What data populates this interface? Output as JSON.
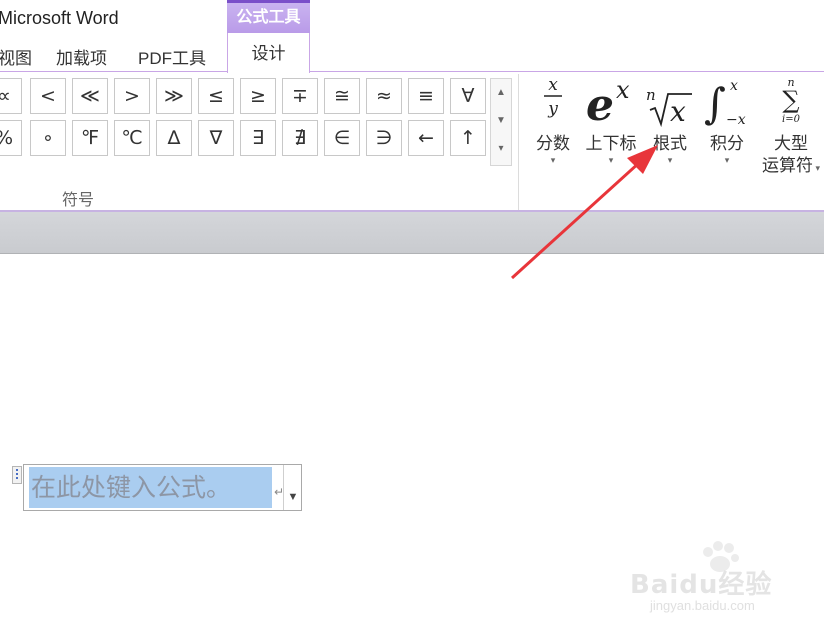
{
  "app": {
    "title": "Microsoft Word"
  },
  "context_tab": {
    "label": "公式工具"
  },
  "tabs": [
    {
      "label": "视图"
    },
    {
      "label": "加载项"
    },
    {
      "label": "PDF工具"
    }
  ],
  "active_tab": {
    "label": "设计"
  },
  "symbols": {
    "row1": [
      "∝",
      "<",
      "≪",
      ">",
      "≫",
      "≤",
      "≥",
      "∓",
      "≅",
      "≈",
      "≡",
      "∀"
    ],
    "row2": [
      "%",
      "∘",
      "℉",
      "℃",
      "∆",
      "∇",
      "∃",
      "∄",
      "∈",
      "∋",
      "←",
      "↑"
    ],
    "group_label": "符号"
  },
  "structures": [
    {
      "label": "分数",
      "icon": "fraction-icon"
    },
    {
      "label": "上下标",
      "icon": "script-icon"
    },
    {
      "label": "根式",
      "icon": "radical-icon"
    },
    {
      "label": "积分",
      "icon": "integral-icon"
    },
    {
      "label": "大型",
      "label2": "运算符",
      "icon": "large-operator-icon"
    }
  ],
  "equation": {
    "placeholder": "在此处键入公式。",
    "return_mark": "↵"
  },
  "watermark": {
    "text": "Baidu经验",
    "url": "jingyan.baidu.com"
  },
  "colors": {
    "context_tab": "#b99ae8",
    "accent_border": "#c9a6e6",
    "selection": "#aacdf0",
    "annotation_arrow": "#e8353a"
  }
}
